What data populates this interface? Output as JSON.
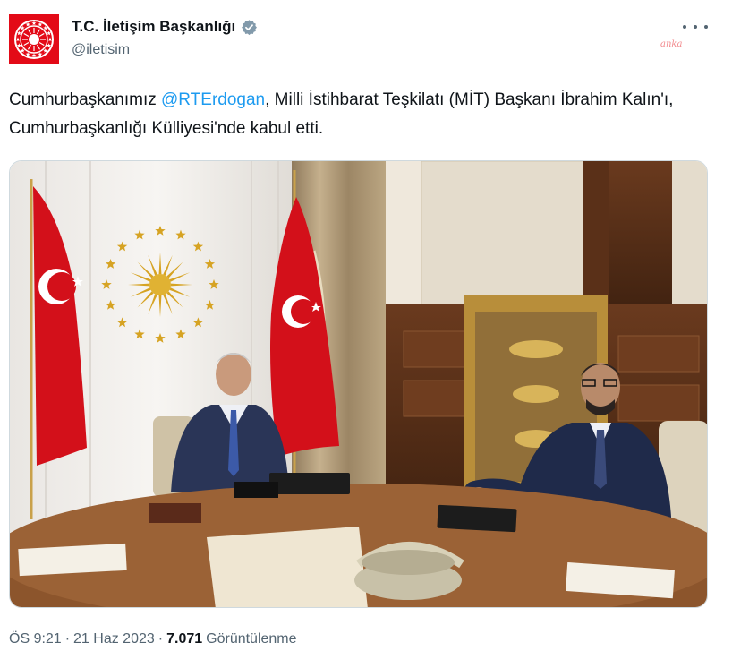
{
  "account": {
    "display_name": "T.C. İletişim Başkanlığı",
    "handle": "@iletisim",
    "verified": true,
    "avatar_icon": "presidential-seal-icon",
    "brand_color": "#e30a17"
  },
  "watermark": "anka",
  "tweet": {
    "text_before": "Cumhurbaşkanımız ",
    "mention": "@RTErdogan",
    "text_after": ", Milli İstihbarat Teşkilatı (MİT) Başkanı İbrahim Kalın'ı, Cumhurbaşkanlığı Külliyesi'nde kabul etti."
  },
  "meta": {
    "time": "ÖS 9:21",
    "separator": "·",
    "date": "21 Haz 2023",
    "views_count": "7.071",
    "views_label": "Görüntülenme"
  },
  "colors": {
    "mention": "#1d9bf0",
    "secondary_text": "#536471",
    "verified_badge": "#829aab"
  }
}
